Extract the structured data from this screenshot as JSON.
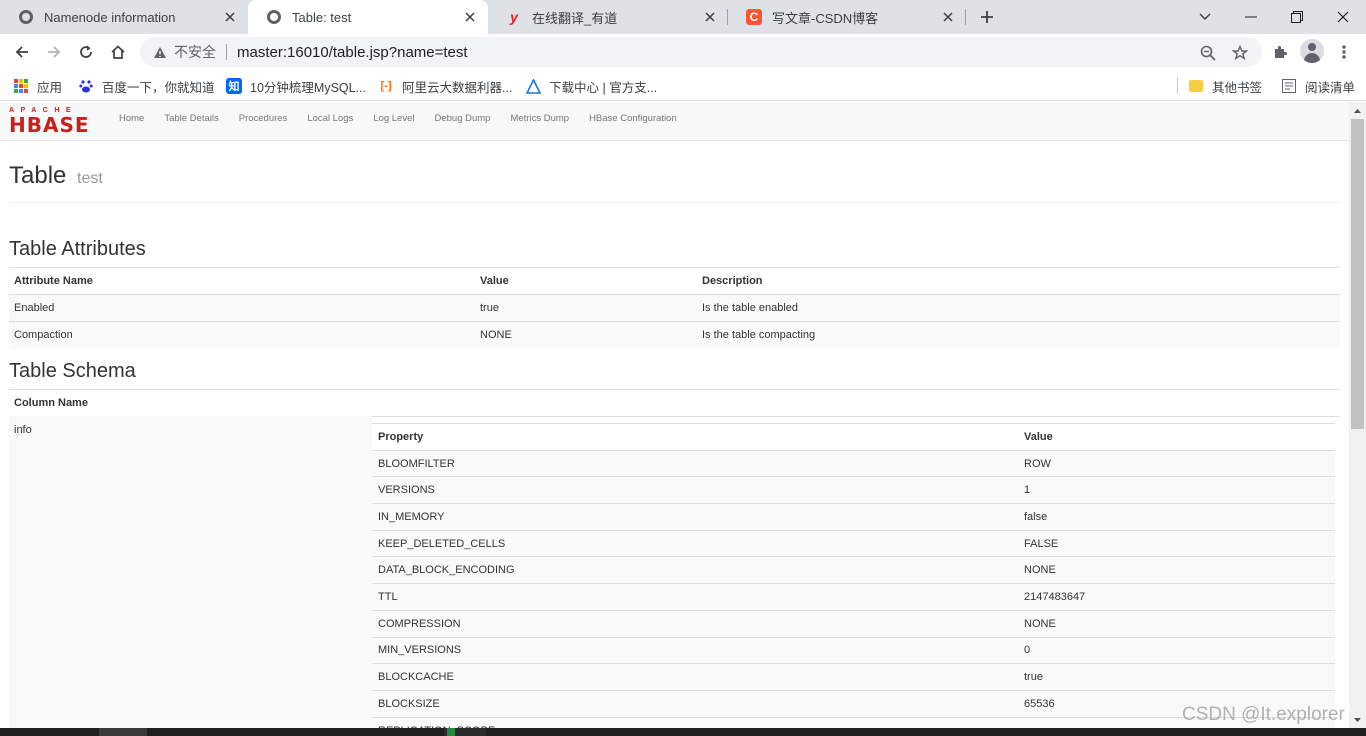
{
  "tabs": [
    {
      "title": "Namenode information",
      "icon": "globe-icon"
    },
    {
      "title": "Table: test",
      "icon": "globe-icon"
    },
    {
      "title": "在线翻译_有道",
      "icon": "youdao-icon"
    },
    {
      "title": "写文章-CSDN博客",
      "icon": "csdn-icon"
    }
  ],
  "omnibox": {
    "security": "不安全",
    "url": "master:16010/table.jsp?name=test"
  },
  "bookmarks": [
    {
      "label": "应用",
      "icon": "apps-icon"
    },
    {
      "label": "百度一下，你就知道",
      "icon": "baidu-icon"
    },
    {
      "label": "10分钟梳理MySQL...",
      "icon": "zhihu-icon"
    },
    {
      "label": "阿里云大数据利器...",
      "icon": "aliyun-icon"
    },
    {
      "label": "下载中心 | 官方支...",
      "icon": "download-icon"
    }
  ],
  "bookmarks_right": [
    {
      "label": "其他书签",
      "icon": "folder-icon"
    },
    {
      "label": "阅读清单",
      "icon": "reading-list-icon"
    }
  ],
  "hbase": {
    "logo_top": "APACHE",
    "logo_main": "HBASE",
    "nav": [
      "Home",
      "Table Details",
      "Procedures",
      "Local Logs",
      "Log Level",
      "Debug Dump",
      "Metrics Dump",
      "HBase Configuration"
    ]
  },
  "page": {
    "title": "Table",
    "subtitle": "test",
    "attributes_heading": "Table Attributes",
    "schema_heading": "Table Schema"
  },
  "attributes": {
    "headers": [
      "Attribute Name",
      "Value",
      "Description"
    ],
    "rows": [
      [
        "Enabled",
        "true",
        "Is the table enabled"
      ],
      [
        "Compaction",
        "NONE",
        "Is the table compacting"
      ]
    ]
  },
  "schema": {
    "column_header": "Column Name",
    "family": "info",
    "prop_headers": [
      "Property",
      "Value"
    ],
    "props": [
      [
        "BLOOMFILTER",
        "ROW"
      ],
      [
        "VERSIONS",
        "1"
      ],
      [
        "IN_MEMORY",
        "false"
      ],
      [
        "KEEP_DELETED_CELLS",
        "FALSE"
      ],
      [
        "DATA_BLOCK_ENCODING",
        "NONE"
      ],
      [
        "TTL",
        "2147483647"
      ],
      [
        "COMPRESSION",
        "NONE"
      ],
      [
        "MIN_VERSIONS",
        "0"
      ],
      [
        "BLOCKCACHE",
        "true"
      ],
      [
        "BLOCKSIZE",
        "65536"
      ],
      [
        "REPLICATION_SCOPE",
        ""
      ]
    ]
  },
  "watermark": "CSDN @It.explorer",
  "colors": {
    "hbase_red": "#c7211e",
    "tabbar": "#dee1e6"
  }
}
